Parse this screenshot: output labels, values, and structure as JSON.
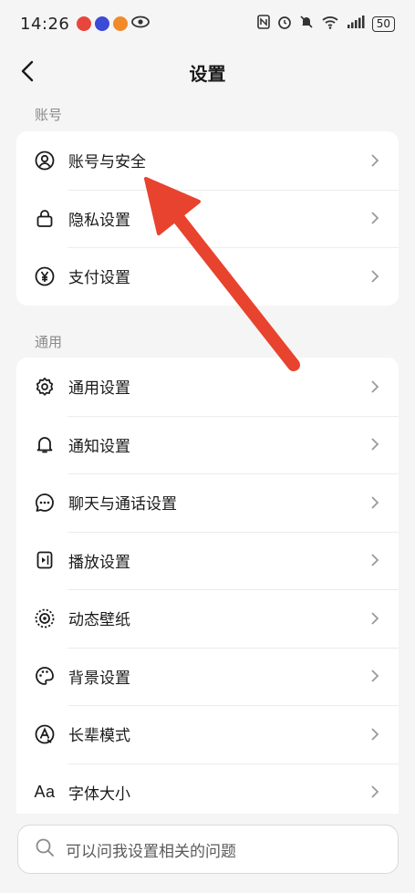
{
  "status_bar": {
    "time": "14:26",
    "battery": "50",
    "app_icon_colors": [
      "#e8453c",
      "#3b4bd6",
      "#f08a2a"
    ]
  },
  "header": {
    "title": "设置"
  },
  "sections": {
    "account": {
      "label": "账号",
      "items": [
        {
          "label": "账号与安全",
          "icon": "user-circle-icon"
        },
        {
          "label": "隐私设置",
          "icon": "lock-icon"
        },
        {
          "label": "支付设置",
          "icon": "yen-icon"
        }
      ]
    },
    "general": {
      "label": "通用",
      "items": [
        {
          "label": "通用设置",
          "icon": "gear-icon"
        },
        {
          "label": "通知设置",
          "icon": "bell-icon"
        },
        {
          "label": "聊天与通话设置",
          "icon": "chat-bubble-icon"
        },
        {
          "label": "播放设置",
          "icon": "play-screen-icon"
        },
        {
          "label": "动态壁纸",
          "icon": "live-wallpaper-icon"
        },
        {
          "label": "背景设置",
          "icon": "palette-icon"
        },
        {
          "label": "长辈模式",
          "icon": "elder-mode-icon"
        },
        {
          "label": "字体大小",
          "icon": "font-size-icon",
          "glyph": "Aa"
        }
      ]
    }
  },
  "search": {
    "placeholder": "可以问我设置相关的问题"
  },
  "annotation": {
    "color": "#e8432e"
  }
}
